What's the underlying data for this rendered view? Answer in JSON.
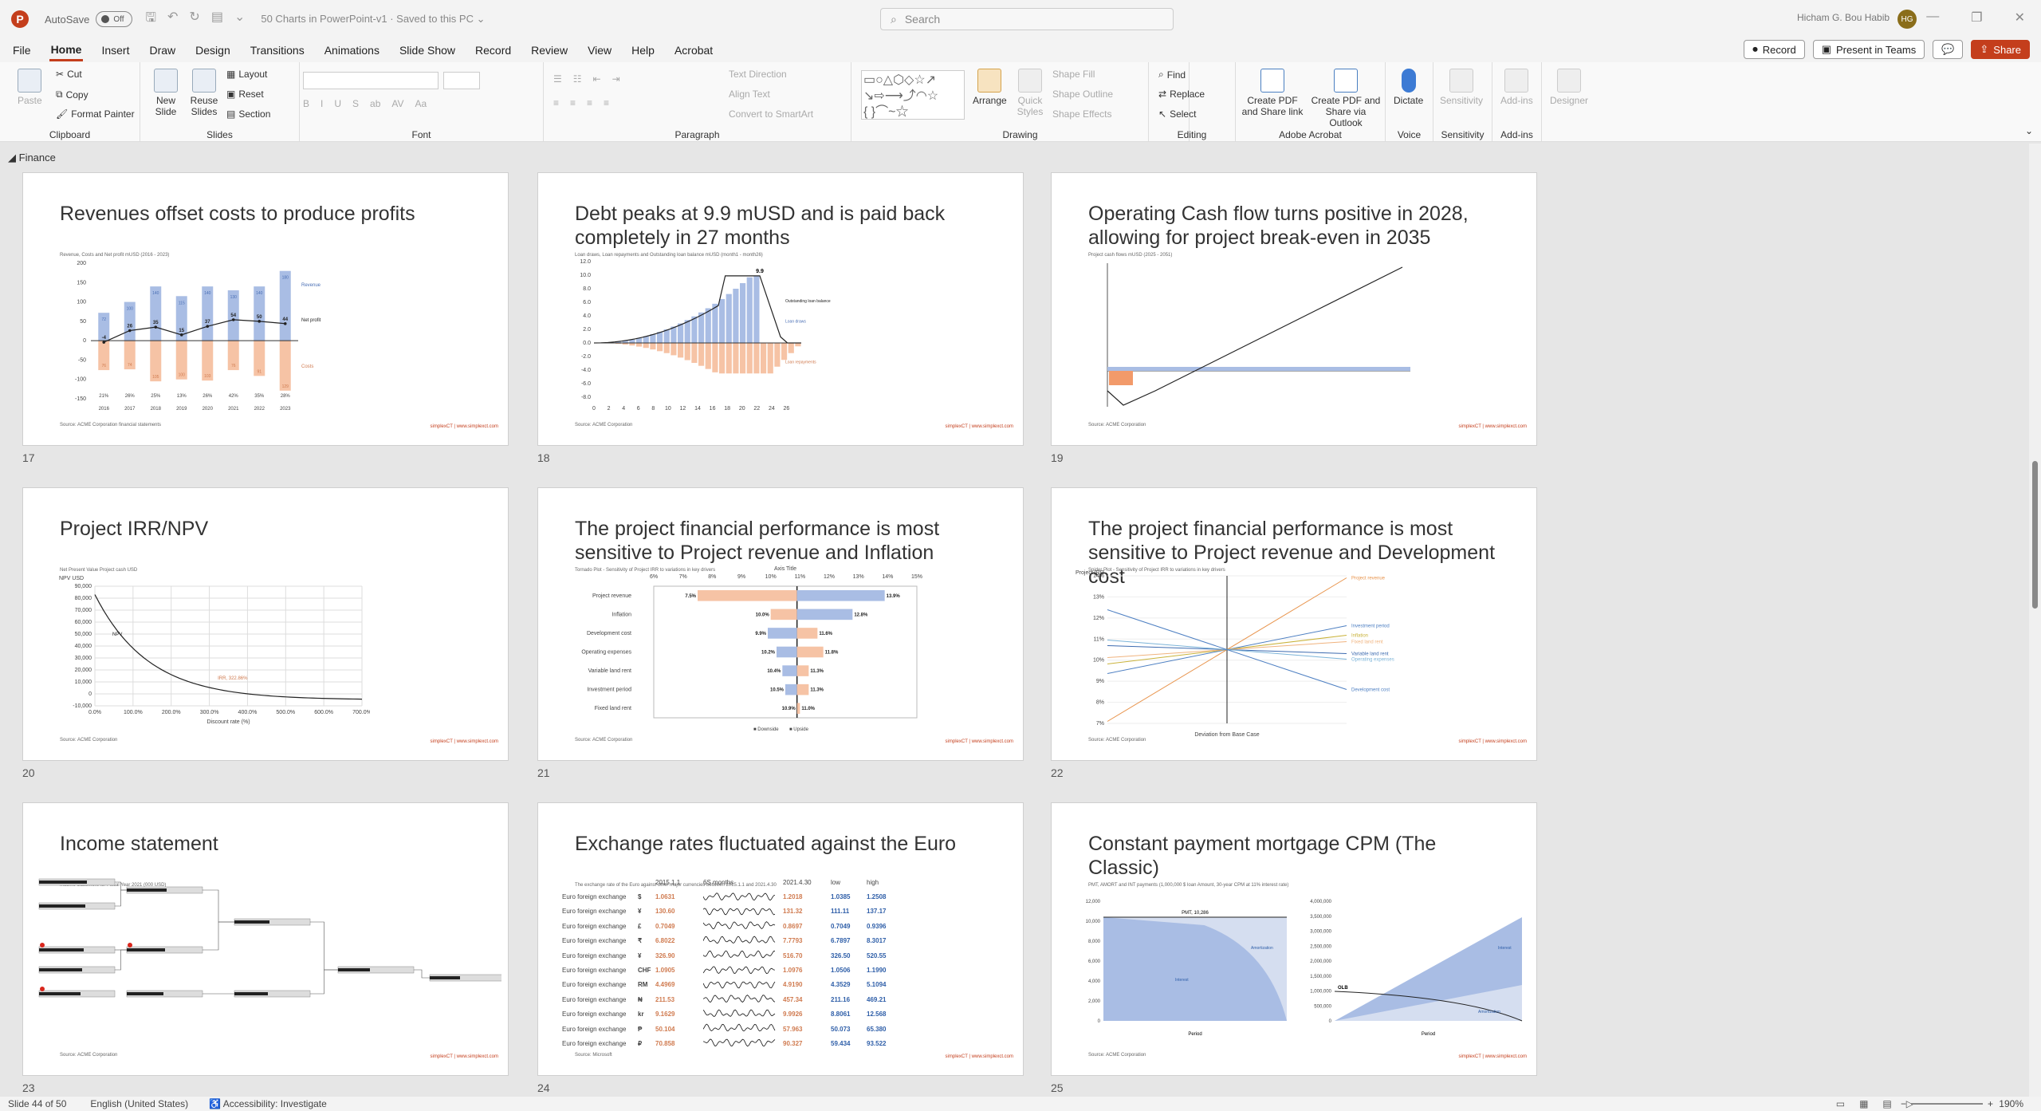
{
  "app": {
    "logo": "P",
    "autosave_label": "AutoSave",
    "autosave_state": "Off",
    "doc_title": "50 Charts in PowerPoint-v1 · Saved to this PC ⌄",
    "search_placeholder": "Search",
    "user_name": "Hicham G. Bou Habib",
    "user_initials": "HG"
  },
  "menu": {
    "items": [
      "File",
      "Home",
      "Insert",
      "Draw",
      "Design",
      "Transitions",
      "Animations",
      "Slide Show",
      "Record",
      "Review",
      "View",
      "Help",
      "Acrobat"
    ],
    "active": "Home",
    "record": "Record",
    "present_teams": "Present in Teams",
    "share": "Share"
  },
  "ribbon": {
    "clipboard": {
      "label": "Clipboard",
      "paste": "Paste",
      "cut": "Cut",
      "copy": "Copy",
      "format_painter": "Format Painter"
    },
    "slides": {
      "label": "Slides",
      "new_slide": "New Slide",
      "reuse": "Reuse Slides",
      "layout": "Layout",
      "reset": "Reset",
      "section": "Section"
    },
    "font": {
      "label": "Font",
      "buttons": [
        "B",
        "I",
        "U",
        "S",
        "ab",
        "AV",
        "Aa"
      ]
    },
    "paragraph": {
      "label": "Paragraph",
      "text_direction": "Text Direction",
      "align_text": "Align Text",
      "convert": "Convert to SmartArt"
    },
    "drawing": {
      "label": "Drawing",
      "arrange": "Arrange",
      "quick_styles": "Quick Styles",
      "shape_fill": "Shape Fill",
      "shape_outline": "Shape Outline",
      "shape_effects": "Shape Effects"
    },
    "editing": {
      "label": "Editing",
      "find": "Find",
      "replace": "Replace",
      "select": "Select"
    },
    "acrobat": {
      "label": "Adobe Acrobat",
      "create_pdf": "Create PDF and Share link",
      "create_outlook": "Create PDF and Share via Outlook"
    },
    "voice": {
      "label": "Voice",
      "dictate": "Dictate"
    },
    "sensitivity": {
      "label": "Sensitivity",
      "btn": "Sensitivity"
    },
    "addins": {
      "label": "Add-ins",
      "btn": "Add-ins"
    },
    "designer": {
      "btn": "Designer"
    }
  },
  "section": {
    "name": "Finance"
  },
  "slides": [
    {
      "num": "17",
      "title": "Revenues offset costs to produce profits",
      "subtitle": "Revenue, Costs and Net profit mUSD (2016 - 2023)",
      "source": "Source: ACME Corporation financial statements"
    },
    {
      "num": "18",
      "title": "Debt peaks at 9.9 mUSD and is paid back completely in 27 months",
      "subtitle": "Loan draws, Loan repayments and Outstanding loan balance mUSD (month1 - month26)",
      "source": "Source: ACME Corporation"
    },
    {
      "num": "19",
      "title": "Operating Cash flow turns positive in 2028, allowing for project break-even in 2035",
      "subtitle": "Project cash flows mUSD (2025 - 2051)",
      "source": "Source: ACME Corporation"
    },
    {
      "num": "20",
      "title": "Project IRR/NPV",
      "subtitle": "Net Present Value Project cash USD",
      "source": "Source: ACME Corporation"
    },
    {
      "num": "21",
      "title": "The project financial performance is most sensitive to Project revenue and Inflation",
      "subtitle": "Tornado Plot - Sensitivity of Project IRR to variations in key drivers",
      "source": "Source: ACME Corporation"
    },
    {
      "num": "22",
      "title": "The project financial performance is most sensitive to Project revenue and Development cost",
      "subtitle": "Spider Plot - Sensitivity of Project IRR to variations in key drivers",
      "source": "Source: ACME Corporation"
    },
    {
      "num": "23",
      "title": "Income statement",
      "subtitle": "Income Statement for Fiscal Year 2021 (000 USD)",
      "source": "Source: ACME Corporation"
    },
    {
      "num": "24",
      "title": "Exchange rates fluctuated against the Euro",
      "subtitle": "The exchange rate of the Euro against other major currencies between 2015.1.1 and 2021.4.30",
      "source": "Source: Microsoft"
    },
    {
      "num": "25",
      "title": "Constant payment mortgage CPM (The Classic)",
      "subtitle": "PMT, AMORT and INT payments (1,000,000 $ loan Amount, 30-year CPM at 11% interest rate)",
      "source": "Source: ACME Corporation"
    }
  ],
  "brand": "simplexCT | www.simplexct.com",
  "chart_data": [
    {
      "type": "bar",
      "slide": "17",
      "categories": [
        "2016",
        "2017",
        "2018",
        "2019",
        "2020",
        "2021",
        "2022",
        "2023"
      ],
      "series": [
        {
          "name": "Revenue",
          "values": [
            72,
            100,
            140,
            115,
            140,
            130,
            140,
            180
          ]
        },
        {
          "name": "Costs",
          "values": [
            -76,
            -74,
            -105,
            -100,
            -103,
            -76,
            -91,
            -129
          ]
        },
        {
          "name": "Net profit",
          "values": [
            -4,
            26,
            35,
            15,
            37,
            54,
            50,
            44
          ]
        }
      ],
      "net_profit_margin": [
        "21%",
        "26%",
        "25%",
        "13%",
        "26%",
        "42%",
        "35%",
        "28%"
      ],
      "ylim": [
        -150,
        200
      ]
    },
    {
      "type": "bar",
      "slide": "18",
      "x": [
        0,
        2,
        4,
        6,
        8,
        10,
        12,
        14,
        16,
        18,
        20,
        22,
        24,
        26
      ],
      "peak": "9.9",
      "ylim": [
        -8,
        12
      ],
      "series": [
        {
          "name": "Outstanding loan balance"
        },
        {
          "name": "Loan draws"
        },
        {
          "name": "Loan repayments"
        }
      ]
    },
    {
      "type": "line",
      "slide": "20",
      "series": [
        {
          "name": "NPV"
        }
      ],
      "xlabel": "Discount rate (%)",
      "ylabel": "NPV USD",
      "xticks": [
        "0.0%",
        "100.0%",
        "200.0%",
        "300.0%",
        "400.0%",
        "500.0%",
        "600.0%",
        "700.0%"
      ],
      "yticks": [
        "90,000",
        "80,000",
        "70,000",
        "60,000",
        "50,000",
        "40,000",
        "30,000",
        "20,000",
        "10,000",
        "0",
        "-10,000"
      ],
      "annotation": "IRR, 322.86%"
    },
    {
      "type": "bar",
      "slide": "21",
      "title": "Axis Title",
      "categories": [
        "Project revenue",
        "Inflation",
        "Development cost",
        "Operating expenses",
        "Variable land rent",
        "Investment period",
        "Fixed land rent"
      ],
      "downside": [
        7.5,
        10.0,
        9.9,
        10.2,
        10.4,
        10.5,
        10.9
      ],
      "upside": [
        13.9,
        12.8,
        11.6,
        11.8,
        11.3,
        11.3,
        11.0
      ],
      "xticks": [
        "6%",
        "7%",
        "8%",
        "9%",
        "10%",
        "11%",
        "12%",
        "13%",
        "14%",
        "15%"
      ],
      "series": [
        {
          "name": "Downside"
        },
        {
          "name": "Upside"
        }
      ]
    },
    {
      "type": "line",
      "slide": "22",
      "xlabel": "Deviation from Base Case",
      "ylabel": "Project IRR",
      "series": [
        {
          "name": "Project revenue"
        },
        {
          "name": "Investment period"
        },
        {
          "name": "Inflation"
        },
        {
          "name": "Fixed land rent"
        },
        {
          "name": "Variable land rent"
        },
        {
          "name": "Operating expenses"
        },
        {
          "name": "Development cost"
        }
      ]
    },
    {
      "type": "table",
      "slide": "24",
      "columns": [
        "",
        "",
        "2015.1.1",
        "6S months",
        "2021.4.30",
        "low",
        "high"
      ],
      "rows": [
        [
          "Euro foreign exchange",
          "$",
          "1.0631",
          "1.2018",
          "1.0385",
          "1.2508"
        ],
        [
          "Euro foreign exchange",
          "¥",
          "130.60",
          "131.32",
          "111.11",
          "137.17"
        ],
        [
          "Euro foreign exchange",
          "£",
          "0.7049",
          "0.8697",
          "0.7049",
          "0.9396"
        ],
        [
          "Euro foreign exchange",
          "₹",
          "6.8022",
          "7.7793",
          "6.7897",
          "8.3017"
        ],
        [
          "Euro foreign exchange",
          "¥",
          "326.90",
          "516.70",
          "326.50",
          "520.55"
        ],
        [
          "Euro foreign exchange",
          "CHF",
          "1.0905",
          "1.0976",
          "1.0506",
          "1.1990"
        ],
        [
          "Euro foreign exchange",
          "RM",
          "4.4969",
          "4.9190",
          "4.3529",
          "5.1094"
        ],
        [
          "Euro foreign exchange",
          "₦",
          "211.53",
          "457.34",
          "211.16",
          "469.21"
        ],
        [
          "Euro foreign exchange",
          "kr",
          "9.1629",
          "9.9926",
          "8.8061",
          "12.568"
        ],
        [
          "Euro foreign exchange",
          "₱",
          "50.104",
          "57.963",
          "50.073",
          "65.380"
        ],
        [
          "Euro foreign exchange",
          "₽",
          "70.858",
          "90.327",
          "59.434",
          "93.522"
        ]
      ]
    },
    {
      "type": "area",
      "slide": "25",
      "annotations": [
        "PMT, 10,286",
        "Interest",
        "Amortization",
        "OLB"
      ],
      "xlabel": "Period"
    }
  ],
  "status": {
    "slide_info": "Slide 44 of 50",
    "language": "English (United States)",
    "accessibility": "Accessibility: Investigate",
    "zoom": "190%"
  }
}
